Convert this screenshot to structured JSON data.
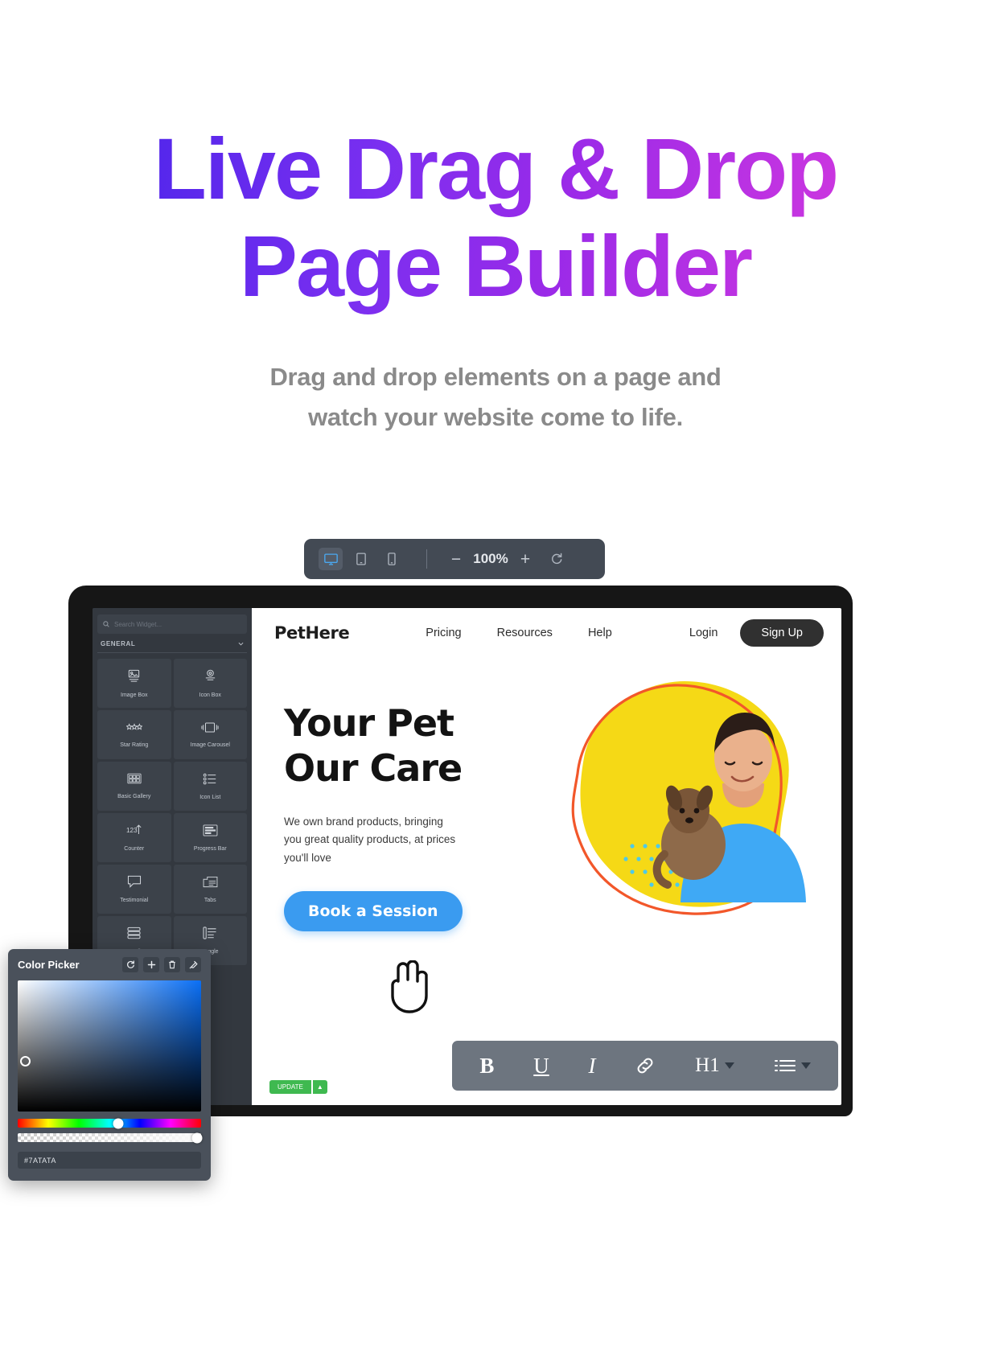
{
  "hero": {
    "title_line1": "Live Drag & Drop",
    "title_line2": "Page Builder",
    "subtitle_line1": "Drag and drop elements on a page and",
    "subtitle_line2": "watch your website come to life.",
    "gradient_start": "#3a21e8",
    "gradient_end": "#e93ddb",
    "subtitle_color": "#8a8a8a"
  },
  "toolbar": {
    "devices": [
      {
        "name": "desktop",
        "icon": "monitor-icon",
        "active": true
      },
      {
        "name": "tablet",
        "icon": "tablet-icon",
        "active": false
      },
      {
        "name": "mobile",
        "icon": "mobile-icon",
        "active": false
      }
    ],
    "zoom_out_label": "−",
    "zoom_value": "100%",
    "zoom_in_label": "+",
    "reload_icon": "reload-icon",
    "background": "#434a54",
    "active_color": "#4aa8f0"
  },
  "sidebar": {
    "search_placeholder": "Search Widget...",
    "category_label": "GENERAL",
    "widgets": [
      {
        "label": "Image Box",
        "icon": "image-box-icon"
      },
      {
        "label": "Icon Box",
        "icon": "icon-box-icon"
      },
      {
        "label": "Star Rating",
        "icon": "star-rating-icon"
      },
      {
        "label": "Image Carousel",
        "icon": "image-carousel-icon"
      },
      {
        "label": "Basic Gallery",
        "icon": "basic-gallery-icon"
      },
      {
        "label": "Icon List",
        "icon": "icon-list-icon"
      },
      {
        "label": "Counter",
        "icon": "counter-icon"
      },
      {
        "label": "Progress Bar",
        "icon": "progress-bar-icon"
      },
      {
        "label": "Testimonial",
        "icon": "testimonial-icon"
      },
      {
        "label": "Tabs",
        "icon": "tabs-icon"
      },
      {
        "label": "Accordion",
        "icon": "accordion-icon"
      },
      {
        "label": "Toggle",
        "icon": "toggle-icon"
      }
    ],
    "publish_label": "UPDATE",
    "publish_caret": "▲"
  },
  "preview": {
    "logo": "PetHere",
    "nav_links": [
      "Pricing",
      "Resources",
      "Help"
    ],
    "login_label": "Login",
    "signup_label": "Sign Up",
    "heading_line1": "Your Pet",
    "heading_line2": "Our Care",
    "paragraph": "We own brand products, bringing you great quality products, at prices you'll love",
    "cta_label": "Book a Session",
    "cta_color": "#3a9bf0",
    "blob_color": "#f5d916",
    "outline_color": "#f2572a",
    "dots_color": "#4ec9e8",
    "cursor_icon": "hand-cursor-icon"
  },
  "rich_text_toolbar": {
    "items": [
      {
        "label": "B",
        "name": "bold-button"
      },
      {
        "label": "U",
        "name": "underline-button"
      },
      {
        "label": "I",
        "name": "italic-button"
      },
      {
        "label": "🔗",
        "name": "link-button"
      },
      {
        "label": "H1",
        "name": "heading-dropdown"
      },
      {
        "label": "☰",
        "name": "list-dropdown"
      }
    ],
    "background": "#6d757f"
  },
  "color_picker": {
    "title": "Color Picker",
    "actions": [
      {
        "name": "reset-icon",
        "glyph": "↺"
      },
      {
        "name": "add-icon",
        "glyph": "+"
      },
      {
        "name": "delete-icon",
        "glyph": "🗑"
      },
      {
        "name": "eyedropper-icon",
        "glyph": "✒"
      }
    ],
    "hex_value": "#7ATATA",
    "hue_position_pct": 55,
    "alpha_position_pct": 100,
    "selected_color": "#0a6ff5"
  }
}
